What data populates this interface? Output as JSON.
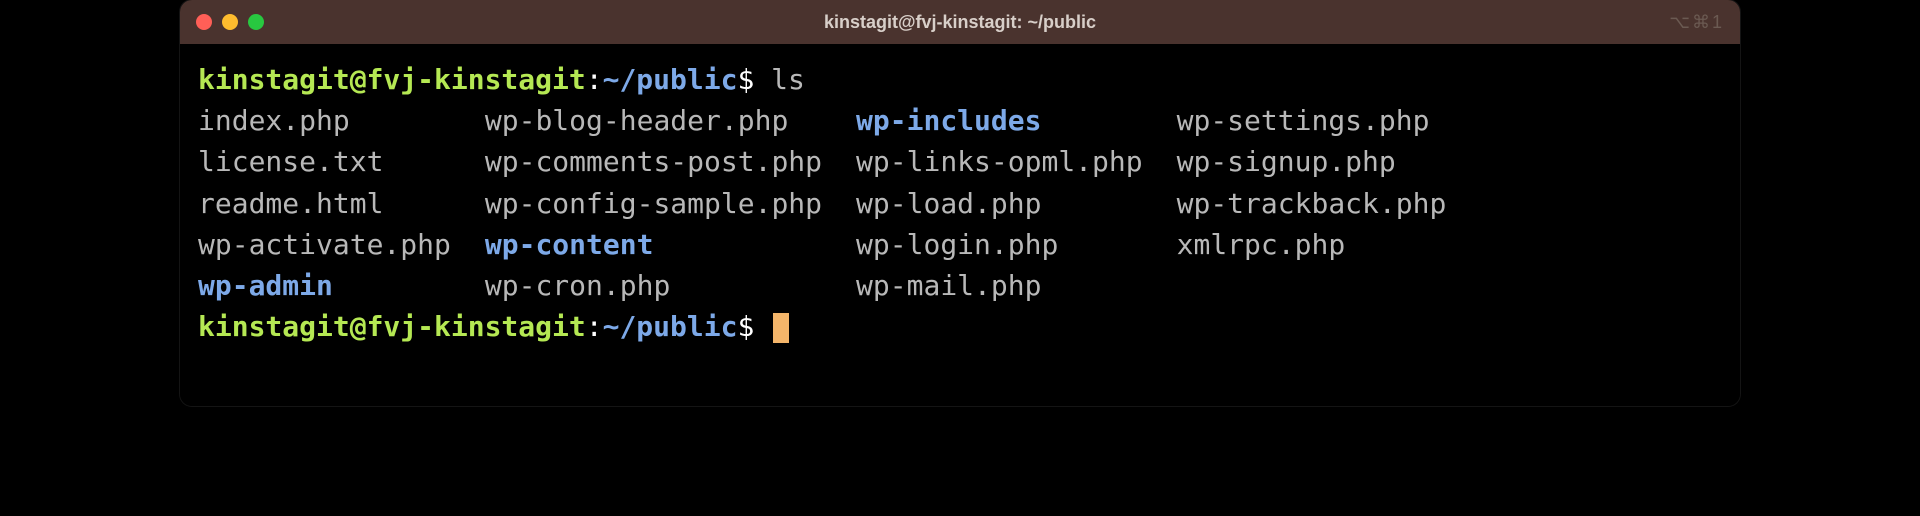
{
  "titlebar": {
    "title": "kinstagit@fvj-kinstagit: ~/public",
    "right_icons": "⌥⌘1"
  },
  "prompt": {
    "user_host": "kinstagit@fvj-kinstagit",
    "colon": ":",
    "path": "~/public",
    "dollar": "$"
  },
  "command": "ls",
  "listing": [
    {
      "name": "index.php",
      "type": "file"
    },
    {
      "name": "wp-blog-header.php",
      "type": "file"
    },
    {
      "name": "wp-includes",
      "type": "dir"
    },
    {
      "name": "wp-settings.php",
      "type": "file"
    },
    {
      "name": "license.txt",
      "type": "file"
    },
    {
      "name": "wp-comments-post.php",
      "type": "file"
    },
    {
      "name": "wp-links-opml.php",
      "type": "file"
    },
    {
      "name": "wp-signup.php",
      "type": "file"
    },
    {
      "name": "readme.html",
      "type": "file"
    },
    {
      "name": "wp-config-sample.php",
      "type": "file"
    },
    {
      "name": "wp-load.php",
      "type": "file"
    },
    {
      "name": "wp-trackback.php",
      "type": "file"
    },
    {
      "name": "wp-activate.php",
      "type": "file"
    },
    {
      "name": "wp-content",
      "type": "dir"
    },
    {
      "name": "wp-login.php",
      "type": "file"
    },
    {
      "name": "xmlrpc.php",
      "type": "file"
    },
    {
      "name": "wp-admin",
      "type": "dir"
    },
    {
      "name": "wp-cron.php",
      "type": "file"
    },
    {
      "name": "wp-mail.php",
      "type": "file"
    }
  ]
}
